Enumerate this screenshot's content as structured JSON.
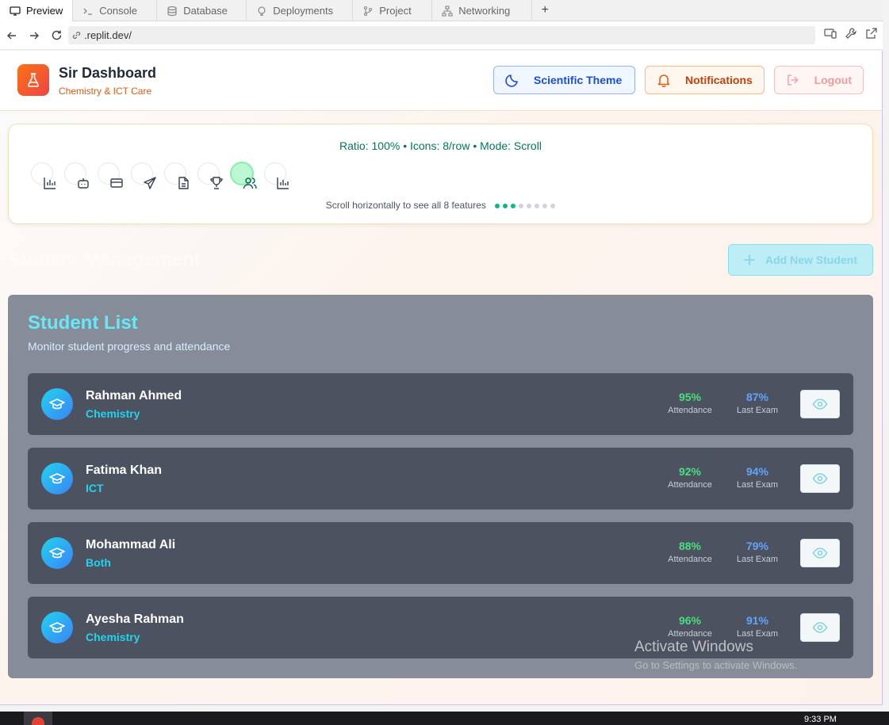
{
  "browser": {
    "tabs": [
      {
        "label": "Preview",
        "icon": "monitor-icon",
        "active": true
      },
      {
        "label": "Console",
        "icon": "terminal-icon",
        "active": false
      },
      {
        "label": "Database",
        "icon": "database-icon",
        "active": false
      },
      {
        "label": "Deployments",
        "icon": "deploy-icon",
        "active": false
      },
      {
        "label": "Project",
        "icon": "git-branch-icon",
        "active": false
      },
      {
        "label": "Networking",
        "icon": "network-icon",
        "active": false
      }
    ],
    "new_tab_label": "+",
    "url": ".replit.dev/"
  },
  "header": {
    "app_title": "Sir Dashboard",
    "app_subtitle": "Chemistry & ICT Care",
    "theme_button": "Scientific Theme",
    "notifications_button": "Notifications",
    "logout_button": "Logout"
  },
  "features": {
    "ratio_text": "Ratio: 100% • Icons: 8/row • Mode: Scroll",
    "icons": [
      "bar-chart-icon",
      "bot-icon",
      "credit-card-icon",
      "send-icon",
      "document-icon",
      "trophy-icon",
      "users-icon",
      "bar-chart-icon"
    ],
    "active_index": 6,
    "scroll_hint": "Scroll horizontally to see all 8 features",
    "dots_total": 8,
    "dots_active": 3
  },
  "students": {
    "section_title": "Student Management",
    "add_button": "Add New Student",
    "list_title": "Student List",
    "list_subtitle": "Monitor student progress and attendance",
    "attendance_label": "Attendance",
    "exam_label": "Last Exam",
    "rows": [
      {
        "name": "Rahman Ahmed",
        "subject": "Chemistry",
        "attendance": "95%",
        "last_exam": "87%"
      },
      {
        "name": "Fatima Khan",
        "subject": "ICT",
        "attendance": "92%",
        "last_exam": "94%"
      },
      {
        "name": "Mohammad Ali",
        "subject": "Both",
        "attendance": "88%",
        "last_exam": "79%"
      },
      {
        "name": "Ayesha Rahman",
        "subject": "Chemistry",
        "attendance": "96%",
        "last_exam": "91%"
      }
    ]
  },
  "watermark": {
    "line1": "Activate Windows",
    "line2": "Go to Settings to activate Windows."
  },
  "taskbar": {
    "time": "9:33 PM"
  },
  "colors": {
    "accent_orange": "#ea580c",
    "accent_cyan": "#22d3ee",
    "attendance_green": "#4ade80",
    "exam_blue": "#60a5fa"
  }
}
